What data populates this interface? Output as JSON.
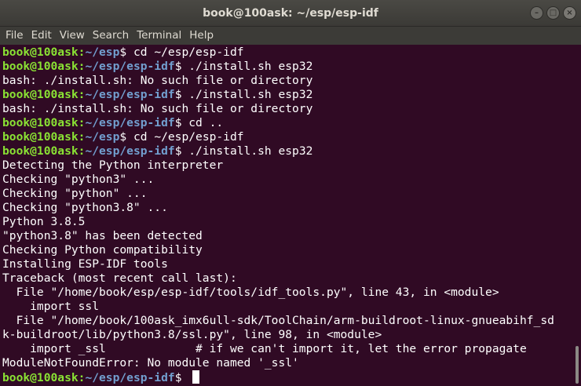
{
  "window": {
    "title": "book@100ask: ~/esp/esp-idf",
    "minimize_glyph": "–",
    "maximize_glyph": "□",
    "close_glyph": "×"
  },
  "menu": [
    "File",
    "Edit",
    "View",
    "Search",
    "Terminal",
    "Help"
  ],
  "terminal": {
    "prompt_user": "book@100ask",
    "prompt_colon": ":",
    "lines": [
      {
        "type": "prompt",
        "path": "~/esp",
        "cmd": "$ cd ~/esp/esp-idf"
      },
      {
        "type": "prompt",
        "path": "~/esp/esp-idf",
        "cmd": "$ ./install.sh esp32"
      },
      {
        "type": "output",
        "text": "bash: ./install.sh: No such file or directory"
      },
      {
        "type": "prompt",
        "path": "~/esp/esp-idf",
        "cmd": "$ ./install.sh esp32"
      },
      {
        "type": "output",
        "text": "bash: ./install.sh: No such file or directory"
      },
      {
        "type": "prompt",
        "path": "~/esp/esp-idf",
        "cmd": "$ cd .."
      },
      {
        "type": "prompt",
        "path": "~/esp",
        "cmd": "$ cd ~/esp/esp-idf"
      },
      {
        "type": "prompt",
        "path": "~/esp/esp-idf",
        "cmd": "$ ./install.sh esp32"
      },
      {
        "type": "output",
        "text": "Detecting the Python interpreter"
      },
      {
        "type": "output",
        "text": "Checking \"python3\" ..."
      },
      {
        "type": "output",
        "text": "Checking \"python\" ..."
      },
      {
        "type": "output",
        "text": "Checking \"python3.8\" ..."
      },
      {
        "type": "output",
        "text": "Python 3.8.5"
      },
      {
        "type": "output",
        "text": "\"python3.8\" has been detected"
      },
      {
        "type": "output",
        "text": "Checking Python compatibility"
      },
      {
        "type": "output",
        "text": "Installing ESP-IDF tools"
      },
      {
        "type": "output",
        "text": "Traceback (most recent call last):"
      },
      {
        "type": "output",
        "text": "  File \"/home/book/esp/esp-idf/tools/idf_tools.py\", line 43, in <module>"
      },
      {
        "type": "output",
        "text": "    import ssl"
      },
      {
        "type": "output",
        "text": "  File \"/home/book/100ask_imx6ull-sdk/ToolChain/arm-buildroot-linux-gnueabihf_sd"
      },
      {
        "type": "output",
        "text": "k-buildroot/lib/python3.8/ssl.py\", line 98, in <module>"
      },
      {
        "type": "output",
        "text": "    import _ssl             # if we can't import it, let the error propagate"
      },
      {
        "type": "output",
        "text": "ModuleNotFoundError: No module named '_ssl'"
      },
      {
        "type": "prompt",
        "path": "~/esp/esp-idf",
        "cmd": "$ ",
        "cursor": true
      }
    ]
  },
  "colors": {
    "background": "#300a24",
    "prompt_user": "#8ae234",
    "prompt_path": "#729fcf",
    "text": "#ffffff"
  }
}
